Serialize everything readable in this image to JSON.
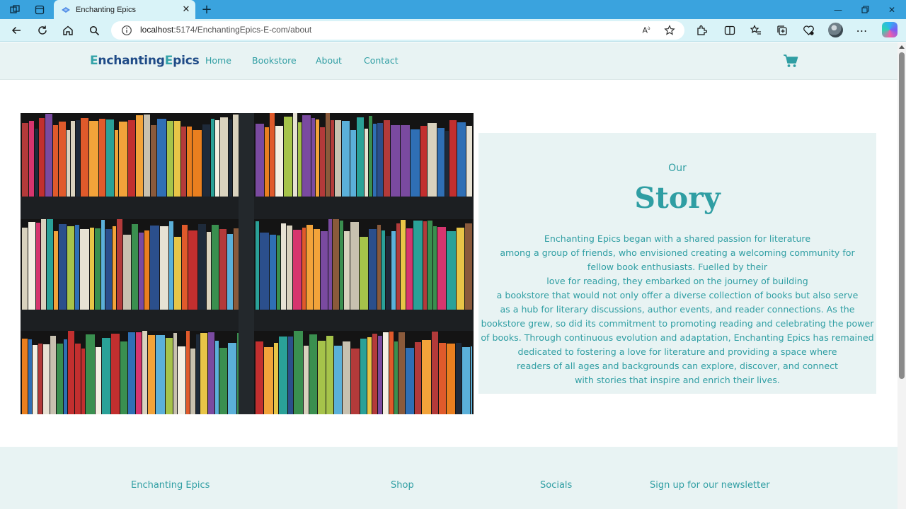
{
  "browser": {
    "tab_title": "Enchanting Epics",
    "url_host": "localhost",
    "url_path": ":5174/EnchantingEpics-E-com/about",
    "accent": "#3aa3de"
  },
  "site": {
    "logo_first": "E",
    "logo_rest": "nchanting",
    "logo_second_first": "E",
    "logo_second_rest": "pics",
    "nav": [
      "Home",
      "Bookstore",
      "About",
      "Contact"
    ],
    "brand_color": "#1f4b87",
    "accent_color": "#2f9ea3",
    "cart_icon": "shopping-cart-icon"
  },
  "story": {
    "pre_title": "Our",
    "title": "Story",
    "lines": [
      "Enchanting Epics began with a shared passion for literature",
      "among a group of friends, who envisioned creating a welcoming community for",
      "fellow book enthusiasts. Fuelled by their",
      "love for reading, they embarked on the journey of building",
      "a bookstore that would not only offer a diverse collection of books but also serve",
      "as a hub for literary discussions, author events, and reader connections. As the",
      "bookstore grew, so did its commitment to promoting reading and celebrating the power",
      "of books. Through continuous evolution and adaptation, Enchanting Epics has remained",
      "dedicated to fostering a love for literature and providing a space where",
      "readers of all ages and backgrounds can explore, discover, and connect",
      "with stories that inspire and enrich their lives."
    ]
  },
  "footer": {
    "brand": "Enchanting Epics",
    "shop": "Shop",
    "socials": "Socials",
    "newsletter": "Sign up for our newsletter"
  }
}
